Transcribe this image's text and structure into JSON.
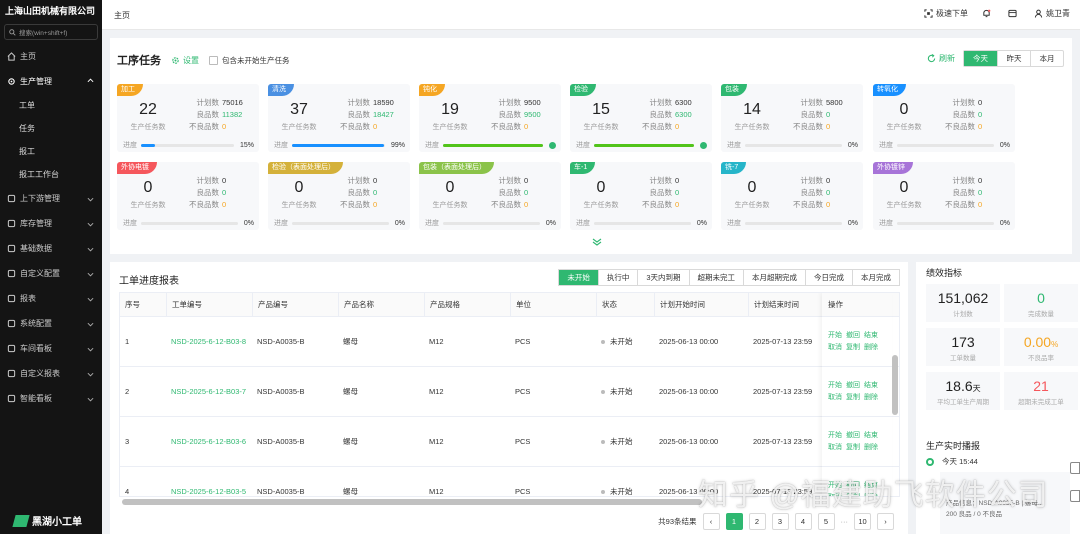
{
  "sidebar": {
    "company": "上海山田机械有限公司",
    "search_placeholder": "搜索(win+shift+f)",
    "items": [
      {
        "label": "主页",
        "icon": "home-icon"
      },
      {
        "label": "生产管理",
        "icon": "gear-icon"
      }
    ],
    "sub_items": [
      "工单",
      "任务",
      "报工",
      "报工工作台"
    ],
    "more_items": [
      {
        "label": "上下游管理",
        "icon": "chain-icon"
      },
      {
        "label": "库存管理",
        "icon": "warehouse-icon"
      },
      {
        "label": "基础数据",
        "icon": "database-icon"
      },
      {
        "label": "自定义配置",
        "icon": "config-icon"
      },
      {
        "label": "报表",
        "icon": "report-icon"
      },
      {
        "label": "系统配置",
        "icon": "settings-icon"
      },
      {
        "label": "车间看板",
        "icon": "dashboard-icon"
      },
      {
        "label": "自定义报表",
        "icon": "custom-report-icon"
      },
      {
        "label": "智能看板",
        "icon": "smart-board-icon"
      }
    ],
    "brand": "黑湖小工单"
  },
  "topbar": {
    "breadcrumb": "主页",
    "quick_order": "极速下单",
    "user": "姚卫青"
  },
  "tasks": {
    "title": "工序任务",
    "settings": "设置",
    "include_unstarted": "包含未开始生产任务",
    "refresh": "刷新",
    "ranges": [
      "今天",
      "昨天",
      "本月"
    ],
    "active_range": "今天",
    "labels": {
      "plan": "计划数",
      "good": "良品数",
      "bad": "不良品数",
      "sub": "生产任务数",
      "progress": "进度"
    },
    "cards": [
      {
        "tag": "加工",
        "color": "#f5a623",
        "count": "22",
        "plan": "75016",
        "good": "11382",
        "bad": "0",
        "pct": "15%",
        "progress": 0.15,
        "bar": "#1890ff",
        "done": false
      },
      {
        "tag": "清洗",
        "color": "#4a90e2",
        "count": "37",
        "plan": "18590",
        "good": "18427",
        "bad": "0",
        "pct": "99%",
        "progress": 0.99,
        "bar": "#1890ff",
        "done": false
      },
      {
        "tag": "钝化",
        "color": "#f5a623",
        "count": "19",
        "plan": "9500",
        "good": "9500",
        "bad": "0",
        "pct": "",
        "progress": 1,
        "bar": "#52c41a",
        "done": true
      },
      {
        "tag": "检验",
        "color": "#2fb871",
        "count": "15",
        "plan": "6300",
        "good": "6300",
        "bad": "0",
        "pct": "",
        "progress": 1,
        "bar": "#52c41a",
        "done": true
      },
      {
        "tag": "包装",
        "color": "#2fb871",
        "count": "14",
        "plan": "5800",
        "good": "0",
        "bad": "0",
        "pct": "0%",
        "progress": 0,
        "bar": "#1890ff",
        "done": false
      },
      {
        "tag": "转氧化",
        "color": "#1890ff",
        "count": "0",
        "plan": "0",
        "good": "0",
        "bad": "0",
        "pct": "0%",
        "progress": 0,
        "bar": "#1890ff",
        "done": false
      },
      {
        "tag": "外协电镀",
        "color": "#f5575c",
        "count": "0",
        "plan": "0",
        "good": "0",
        "bad": "0",
        "pct": "0%",
        "progress": 0,
        "bar": "#1890ff",
        "done": false
      },
      {
        "tag": "检验（表面处理后）",
        "color": "#d4b13a",
        "count": "0",
        "plan": "0",
        "good": "0",
        "bad": "0",
        "pct": "0%",
        "progress": 0,
        "bar": "#1890ff",
        "done": false
      },
      {
        "tag": "包装（表面处理后）",
        "color": "#8bc34a",
        "count": "0",
        "plan": "0",
        "good": "0",
        "bad": "0",
        "pct": "0%",
        "progress": 0,
        "bar": "#1890ff",
        "done": false
      },
      {
        "tag": "车-1",
        "color": "#2fb871",
        "count": "0",
        "plan": "0",
        "good": "0",
        "bad": "0",
        "pct": "0%",
        "progress": 0,
        "bar": "#1890ff",
        "done": false
      },
      {
        "tag": "铣-7",
        "color": "#26b5c9",
        "count": "0",
        "plan": "0",
        "good": "0",
        "bad": "0",
        "pct": "0%",
        "progress": 0,
        "bar": "#1890ff",
        "done": false
      },
      {
        "tag": "外协镀锌",
        "color": "#a774d8",
        "count": "0",
        "plan": "0",
        "good": "0",
        "bad": "0",
        "pct": "0%",
        "progress": 0,
        "bar": "#1890ff",
        "done": false
      }
    ]
  },
  "workorders": {
    "title": "工单进度报表",
    "tabs": [
      "未开始",
      "执行中",
      "3天内到期",
      "超期未完工",
      "本月超期完成",
      "今日完成",
      "本月完成"
    ],
    "active_tab": "未开始",
    "columns": [
      "序号",
      "工单编号",
      "产品编号",
      "产品名称",
      "产品规格",
      "单位",
      "状态",
      "计划开始时间",
      "计划结束时间",
      "操作"
    ],
    "rows": [
      {
        "no": "1",
        "code": "NSD-2025-6-12-B03-8",
        "product": "NSD-A0035-B",
        "name": "螺母",
        "spec": "M12",
        "unit": "PCS",
        "status": "未开始",
        "start": "2025-06-13 00:00",
        "end": "2025-07-13 23:59"
      },
      {
        "no": "2",
        "code": "NSD-2025-6-12-B03-7",
        "product": "NSD-A0035-B",
        "name": "螺母",
        "spec": "M12",
        "unit": "PCS",
        "status": "未开始",
        "start": "2025-06-13 00:00",
        "end": "2025-07-13 23:59"
      },
      {
        "no": "3",
        "code": "NSD-2025-6-12-B03-6",
        "product": "NSD-A0035-B",
        "name": "螺母",
        "spec": "M12",
        "unit": "PCS",
        "status": "未开始",
        "start": "2025-06-13 00:00",
        "end": "2025-07-13 23:59"
      },
      {
        "no": "4",
        "code": "NSD-2025-6-12-B03-5",
        "product": "NSD-A0035-B",
        "name": "螺母",
        "spec": "M12",
        "unit": "PCS",
        "status": "未开始",
        "start": "2025-06-13 00:00",
        "end": "2025-07-13 23:59"
      }
    ],
    "ops": {
      "row1": [
        "开始",
        "撤回",
        "结束"
      ],
      "row2": [
        "取消",
        "复制",
        "删除"
      ]
    },
    "total": "共93条结果",
    "pages": [
      "1",
      "2",
      "3",
      "4",
      "5",
      "10"
    ],
    "active_page": "1"
  },
  "performance": {
    "title": "绩效指标",
    "metrics": [
      {
        "value": "151,062",
        "unit": "",
        "label": "计划数",
        "color": "#222"
      },
      {
        "value": "0",
        "unit": "",
        "label": "完成数量",
        "color": "#2fb871"
      },
      {
        "value": "173",
        "unit": "",
        "label": "工单数量",
        "color": "#222"
      },
      {
        "value": "0.00",
        "unit": "%",
        "label": "不良品率",
        "color": "#f5a623"
      },
      {
        "value": "18.6",
        "unit": "天",
        "label": "平均工单生产周期",
        "color": "#222"
      },
      {
        "value": "21",
        "unit": "",
        "label": "超期未完成工单",
        "color": "#f5575c"
      }
    ],
    "realtime_title": "生产实时播报",
    "today": "今天 15:44",
    "feed_line1": "产品信息：NSD-A0035-B | 螺母...",
    "feed_line2": "200 良品 / 0 不良品"
  },
  "watermark": "知乎 @福建助飞软件公司"
}
